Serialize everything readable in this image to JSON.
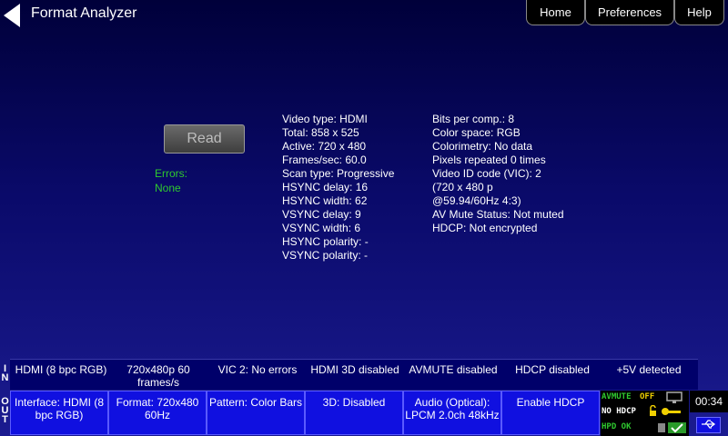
{
  "header": {
    "title": "Format Analyzer",
    "nav": [
      "Home",
      "Preferences",
      "Help"
    ]
  },
  "read_button": "Read",
  "errors": {
    "label": "Errors:",
    "value": "None"
  },
  "info_left": [
    "Video type: HDMI",
    "Total: 858 x 525",
    "Active: 720 x 480",
    "Frames/sec: 60.0",
    "Scan type: Progressive",
    "HSYNC delay: 16",
    "HSYNC width: 62",
    "VSYNC delay: 9",
    "VSYNC width: 6",
    "HSYNC polarity: -",
    "VSYNC polarity: -"
  ],
  "info_right": [
    "Bits per comp.: 8",
    "Color space: RGB",
    "Colorimetry: No data",
    "Pixels repeated 0 times",
    "Video ID code (VIC): 2",
    "(720 x 480 p",
    "@59.94/60Hz 4:3)",
    "AV Mute Status: Not muted",
    "HDCP: Not encrypted"
  ],
  "in_label": "I N",
  "out_label": "O U T",
  "in_status": [
    "HDMI (8 bpc RGB)",
    "720x480p 60 frames/s",
    "VIC 2: No errors",
    "HDMI 3D disabled",
    "AVMUTE disabled",
    "HDCP disabled",
    "+5V detected"
  ],
  "out_controls": [
    "Interface: HDMI (8 bpc RGB)",
    "Format: 720x480 60Hz",
    "Pattern: Color Bars",
    "3D: Disabled",
    "Audio (Optical): LPCM 2.0ch 48kHz",
    "Enable HDCP"
  ],
  "status": {
    "avmute": "AVMUTE",
    "avmute_state": "OFF",
    "hdcp": "NO HDCP",
    "hpd": "HPD OK"
  },
  "time": "00:34",
  "colors": {
    "green": "#2fc92f",
    "yellow": "#f0d000",
    "button_blue": "#1010e0"
  }
}
